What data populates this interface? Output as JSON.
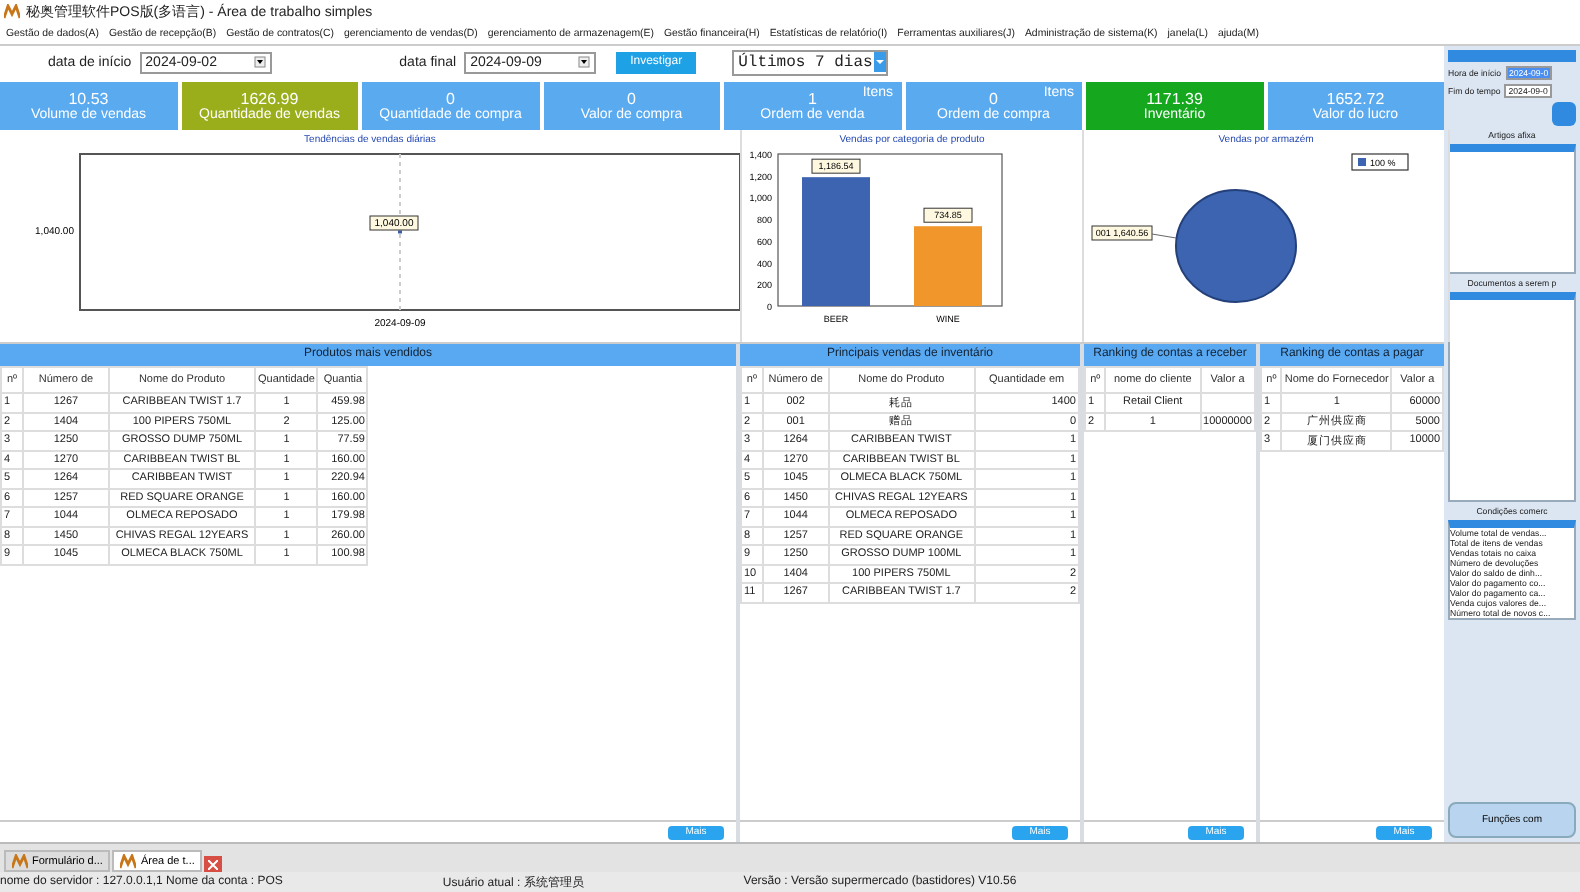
{
  "window": {
    "title": "秘奥管理软件POS版(多语言) - Área de trabalho simples"
  },
  "menu": [
    "Gestão de dados(A)",
    "Gestão de recepção(B)",
    "Gestão de contratos(C)",
    "gerenciamento de vendas(D)",
    "gerenciamento de armazenagem(E)",
    "Gestão financeira(H)",
    "Estatísticas de relatório(I)",
    "Ferramentas auxiliares(J)",
    "Administração de sistema(K)",
    "janela(L)",
    "ajuda(M)"
  ],
  "filters": {
    "start_label": "data de início",
    "start_value": "2024-09-02",
    "end_label": "data final",
    "end_value": "2024-09-09",
    "search_button": "Investigar",
    "period": "Últimos 7 dias"
  },
  "kpis": [
    {
      "value": "10.53",
      "label": "Volume de vendas",
      "color": "#5aaaf0"
    },
    {
      "value": "1626.99",
      "label": "Quantidade de vendas",
      "color": "#9aae1c"
    },
    {
      "value": "0",
      "label": "Quantidade de compra",
      "color": "#5aaaf0"
    },
    {
      "value": "0",
      "label": "Valor de compra",
      "color": "#5aaaf0"
    },
    {
      "value": "1",
      "unit": "Itens",
      "label": "Ordem de venda",
      "color": "#5aaaf0"
    },
    {
      "value": "0",
      "unit": "Itens",
      "label": "Ordem de compra",
      "color": "#5aaaf0"
    },
    {
      "value": "1171.39",
      "label": "Inventário",
      "color": "#15a81e"
    },
    {
      "value": "1652.72",
      "label": "Valor do lucro",
      "color": "#5aaaf0"
    }
  ],
  "charts": [
    {
      "kind": "trend",
      "title": "Tendências de vendas diárias",
      "axis_label": "1,040.00",
      "point_label": "1,040.00",
      "date_label": "2024-09-09"
    },
    {
      "chart_data": {
        "type": "bar",
        "title": "Vendas por categoria de produto",
        "categories": [
          "BEER",
          "WINE"
        ],
        "values": [
          1186.54,
          734.85
        ],
        "ylim": [
          0,
          1400
        ],
        "yticks": [
          {
            "value": 0,
            "label": "0"
          },
          {
            "value": 200,
            "label": "200"
          },
          {
            "value": 400,
            "label": "400"
          },
          {
            "value": 600,
            "label": "600"
          },
          {
            "value": 800,
            "label": "800"
          },
          {
            "value": 1000,
            "label": "1,000"
          },
          {
            "value": 1200,
            "label": "1,200"
          },
          {
            "value": 1400,
            "label": "1,400"
          }
        ],
        "value_labels": [
          "1,186.54",
          "734.85"
        ]
      }
    },
    {
      "chart_data": {
        "type": "pie",
        "title": "Vendas por armazém",
        "values": [
          1640.56
        ],
        "value_labels": [
          "001 1,640.56"
        ],
        "annotations": [
          "100 %"
        ]
      }
    }
  ],
  "tables": [
    {
      "title": "Produtos mais vendidos",
      "columns": [
        "nº",
        "Número de",
        "Nome do Produto",
        "Quantidade",
        "Quantia"
      ],
      "rows": [
        [
          "1",
          "1267",
          "CARIBBEAN TWIST 1.7",
          "1",
          "459.98"
        ],
        [
          "2",
          "1404",
          "100 PIPERS 750ML",
          "2",
          "125.00"
        ],
        [
          "3",
          "1250",
          "GROSSO DUMP 750ML",
          "1",
          "77.59"
        ],
        [
          "4",
          "1270",
          "CARIBBEAN TWIST BL",
          "1",
          "160.00"
        ],
        [
          "5",
          "1264",
          "CARIBBEAN TWIST",
          "1",
          "220.94"
        ],
        [
          "6",
          "1257",
          "RED SQUARE ORANGE",
          "1",
          "160.00"
        ],
        [
          "7",
          "1044",
          "OLMECA REPOSADO",
          "1",
          "179.98"
        ],
        [
          "8",
          "1450",
          "CHIVAS REGAL 12YEARS",
          "1",
          "260.00"
        ],
        [
          "9",
          "1045",
          "OLMECA BLACK 750ML",
          "1",
          "100.98"
        ]
      ],
      "more": "Mais"
    },
    {
      "title": "Principais vendas de inventário",
      "columns": [
        "nº",
        "Número de",
        "Nome do Produto",
        "Quantidade em"
      ],
      "rows": [
        [
          "1",
          "002",
          "耗品",
          "1400"
        ],
        [
          "2",
          "001",
          "赠品",
          "0"
        ],
        [
          "3",
          "1264",
          "CARIBBEAN TWIST",
          "1"
        ],
        [
          "4",
          "1270",
          "CARIBBEAN TWIST BL",
          "1"
        ],
        [
          "5",
          "1045",
          "OLMECA BLACK 750ML",
          "1"
        ],
        [
          "6",
          "1450",
          "CHIVAS REGAL 12YEARS",
          "1"
        ],
        [
          "7",
          "1044",
          "OLMECA REPOSADO",
          "1"
        ],
        [
          "8",
          "1257",
          "RED SQUARE ORANGE",
          "1"
        ],
        [
          "9",
          "1250",
          "GROSSO DUMP 100ML",
          "1"
        ],
        [
          "10",
          "1404",
          "100 PIPERS 750ML",
          "2"
        ],
        [
          "11",
          "1267",
          "CARIBBEAN TWIST 1.7",
          "2"
        ]
      ],
      "more": "Mais"
    },
    {
      "title": "Ranking de contas a receber",
      "columns": [
        "nº",
        "nome do cliente",
        "Valor a"
      ],
      "rows": [
        [
          "1",
          "Retail Client",
          ""
        ],
        [
          "2",
          "1",
          "10000000"
        ]
      ],
      "more": "Mais"
    },
    {
      "title": "Ranking de contas a pagar",
      "columns": [
        "nº",
        "Nome do Fornecedor",
        "Valor a"
      ],
      "rows": [
        [
          "1",
          "1",
          "60000"
        ],
        [
          "2",
          "广州供应商",
          "5000"
        ],
        [
          "3",
          "厦门供应商",
          "10000"
        ]
      ],
      "more": "Mais"
    }
  ],
  "side_panel": {
    "start_label": "Hora de início",
    "start_value": "2024-09-0",
    "end_label": "Fim do tempo",
    "end_value": "2024-09-0",
    "notices_title": "Artigos afixa",
    "documents_title": "Documentos a serem p",
    "conditions_title": "Condições comerc",
    "conditions": [
      "Volume total de vendas...",
      "Total de itens de vendas",
      "Vendas totais no caixa",
      "Número de devoluções",
      "Valor do saldo de dinh...",
      "Valor do pagamento co...",
      "Valor do pagamento ca...",
      "Venda cujos valores de...",
      "Número total de novos c..."
    ],
    "functions_button": "Funções com"
  },
  "taskbar": [
    {
      "label": "Formulário d...",
      "selected": false
    },
    {
      "label": "Área de t...",
      "selected": true
    }
  ],
  "status_bar": [
    "nome do servidor : 127.0.0.1,1 Nome da conta : POS",
    "Usuário atual : 系统管理员",
    "Versão : Versão supermercado (bastidores) V10.56"
  ]
}
